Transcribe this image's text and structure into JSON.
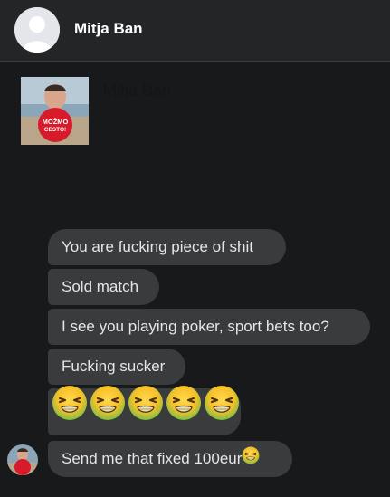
{
  "header": {
    "name": "Mitja Ban"
  },
  "profile": {
    "name": "Mitja Ban",
    "shirt_text": "MOŽMO CESTO!"
  },
  "messages": {
    "m1": "You are fucking piece of shit",
    "m2": "Sold match",
    "m3": "I see you playing poker, sport bets too?",
    "m4": "Fucking sucker",
    "m5_emoji": "nauseated-face-icon x5",
    "m6": "Send me that fixed 100eur"
  },
  "colors": {
    "background": "#18191a",
    "bubble": "#3a3b3c",
    "text": "#e4e6eb"
  }
}
